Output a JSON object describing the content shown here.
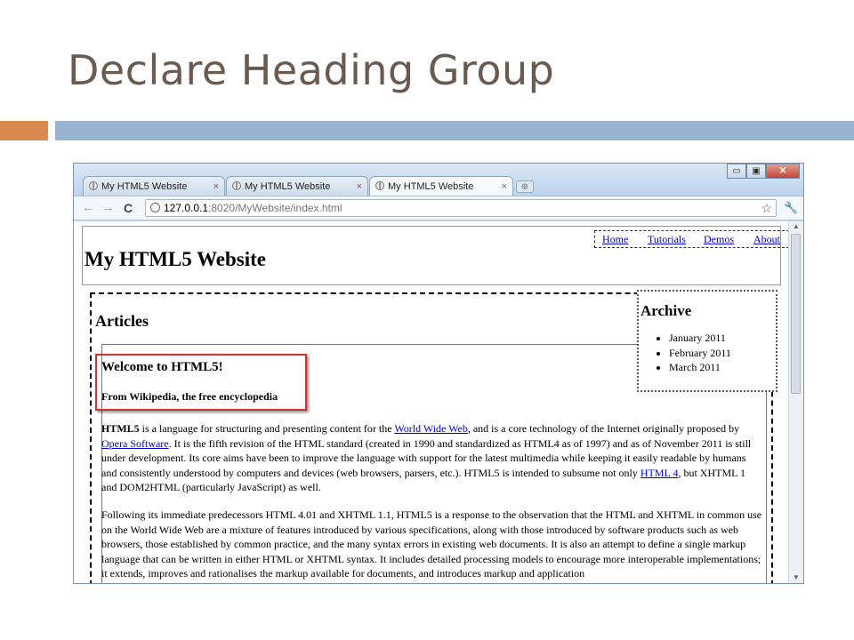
{
  "slide": {
    "title": "Declare Heading Group"
  },
  "browser": {
    "tabs": [
      {
        "label": "My HTML5 Website",
        "close": "×"
      },
      {
        "label": "My HTML5 Website",
        "close": "×"
      },
      {
        "label": "My HTML5 Website",
        "close": "×"
      }
    ],
    "url_host": "127.0.0.1",
    "url_rest": ":8020/MyWebsite/index.html",
    "icons": {
      "back": "←",
      "forward": "→",
      "reload": "C",
      "star": "☆",
      "wrench": "🔧",
      "minimize": "▭",
      "maximize": "▣",
      "close": "✕",
      "new_tab": "⊕"
    }
  },
  "page": {
    "site_title": "My HTML5 Website",
    "nav": [
      "Home",
      "Tutorials",
      "Demos",
      "About"
    ],
    "articles_heading": "Articles",
    "article_title": "Welcome to HTML5!",
    "article_subtitle": "From Wikipedia, the free encyclopedia",
    "para1": {
      "lead": "HTML5",
      "t1": " is a language for structuring and presenting content for the ",
      "link1": "World Wide Web",
      "t2": ", and is a core technology of the Internet originally proposed by ",
      "link2": "Opera Software",
      "t3": ". It is the fifth revision of the HTML standard (created in 1990 and standardized as HTML4 as of 1997) and as of November 2011 is still under development. Its core aims have been to improve the language with support for the latest multimedia while keeping it easily readable by humans and consistently understood by computers and devices (web browsers, parsers, etc.). HTML5 is intended to subsume not only ",
      "link3": "HTML 4",
      "t4": ", but XHTML 1 and DOM2HTML (particularly JavaScript) as well."
    },
    "para2": "Following its immediate predecessors HTML 4.01 and XHTML 1.1, HTML5 is a response to the observation that the HTML and XHTML in common use on the World Wide Web are a mixture of features introduced by various specifications, along with those introduced by software products such as web browsers, those established by common practice, and the many syntax errors in existing web documents. It is also an attempt to define a single markup language that can be written in either HTML or XHTML syntax. It includes detailed processing models to encourage more interoperable implementations; it extends, improves and rationalises the markup available for documents, and introduces markup and application",
    "archive_heading": "Archive",
    "archive_items": [
      "January 2011",
      "February 2011",
      "March 2011"
    ]
  },
  "colors": {
    "title": "#6b5a50",
    "accent_orange": "#d88a50",
    "accent_blue": "#9ab5d1",
    "highlight_box": "#cc3333",
    "link": "#0000cc"
  }
}
